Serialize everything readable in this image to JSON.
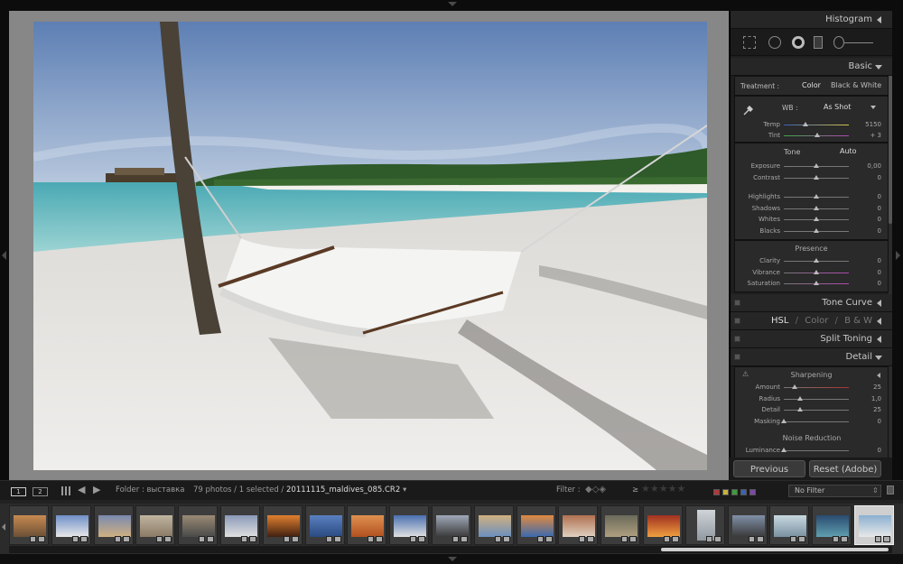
{
  "panel": {
    "histogram": "Histogram",
    "basic": "Basic",
    "treatment_label": "Treatment :",
    "treatment_color": "Color",
    "treatment_bw": "Black & White",
    "wb_label": "WB :",
    "wb_value": "As Shot",
    "temp_label": "Temp",
    "temp_value": "5150",
    "tint_label": "Tint",
    "tint_value": "+ 3",
    "tone_label": "Tone",
    "auto_label": "Auto",
    "tone_rows": [
      {
        "label": "Exposure",
        "value": "0,00",
        "level": 0.5
      },
      {
        "label": "Contrast",
        "value": "0",
        "level": 0.5
      }
    ],
    "region_rows": [
      {
        "label": "Highlights",
        "value": "0",
        "level": 0.5
      },
      {
        "label": "Shadows",
        "value": "0",
        "level": 0.5
      },
      {
        "label": "Whites",
        "value": "0",
        "level": 0.5
      },
      {
        "label": "Blacks",
        "value": "0",
        "level": 0.5
      }
    ],
    "presence_label": "Presence",
    "presence_rows": [
      {
        "label": "Clarity",
        "value": "0",
        "level": 0.5
      },
      {
        "label": "Vibrance",
        "value": "0",
        "level": 0.5
      },
      {
        "label": "Saturation",
        "value": "0",
        "level": 0.5
      }
    ],
    "tone_curve": "Tone Curve",
    "hsl": "HSL",
    "slash": "/",
    "color": "Color",
    "bw": "B & W",
    "split_toning": "Split Toning",
    "detail": "Detail",
    "sharpening_label": "Sharpening",
    "sharpen_rows": [
      {
        "label": "Amount",
        "value": "25",
        "level": 0.17
      },
      {
        "label": "Radius",
        "value": "1,0",
        "level": 0.25
      },
      {
        "label": "Detail",
        "value": "25",
        "level": 0.25
      },
      {
        "label": "Masking",
        "value": "0",
        "level": 0.0
      }
    ],
    "noise_reduction_label": "Noise Reduction",
    "luminance_label": "Luminance",
    "luminance_value": "0",
    "previous_button": "Previous",
    "reset_button": "Reset (Adobe)"
  },
  "filmbar": {
    "monitor_1": "1",
    "monitor_2": "2",
    "folder_label": "Folder : выставка",
    "photo_count": "79 photos / 1 selected / ",
    "filename": "20111115_maldives_085.CR2",
    "filename_arrow": "▾",
    "filter_label": "Filter :",
    "rating_op": "≥",
    "no_filter": "No Filter",
    "label_colors": [
      "#b03a3a",
      "#c8b23a",
      "#3f9a3f",
      "#3a62b0",
      "#7a4aa6"
    ]
  },
  "filmstrip": {
    "thumbnail_count": 21,
    "selected_index": 20
  },
  "colors": {
    "accent": "#cfcfcf",
    "panel_bg": "#2a2a2a"
  }
}
